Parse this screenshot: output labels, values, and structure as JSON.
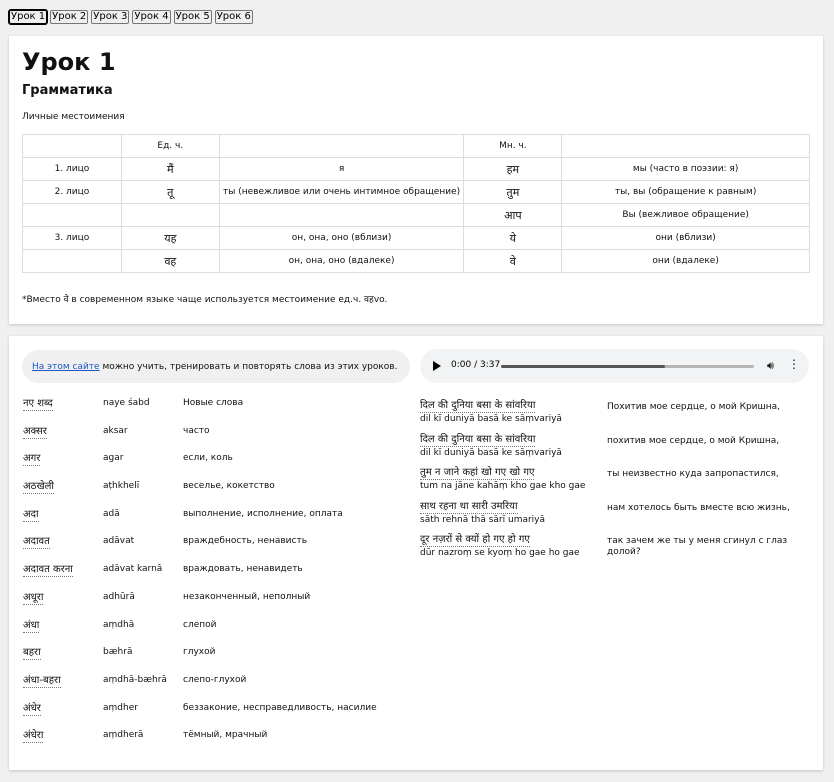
{
  "tabs": [
    "Урок 1",
    "Урок 2",
    "Урок 3",
    "Урок 4",
    "Урок 5",
    "Урок 6"
  ],
  "active_tab": 0,
  "lesson": {
    "title": "Урок 1",
    "section": "Грамматика",
    "subsection": "Личные местоимения",
    "table": {
      "head": [
        "",
        "Ед. ч.",
        "",
        "Мн. ч.",
        ""
      ],
      "rows": [
        [
          "1. лицо",
          "मैं",
          "я",
          "हम",
          "мы (часто в поэзии: я)"
        ],
        [
          "2. лицо",
          "तू",
          "ты (невежливое или очень интимное обращение)",
          "तुम",
          "ты, вы (обращение к равным)"
        ],
        [
          "",
          "",
          "",
          "आप",
          "Вы (вежливое обращение)"
        ],
        [
          "3. лицо",
          "यह",
          "он, она, оно (вблизи)",
          "ये",
          "они (вблизи)"
        ],
        [
          "",
          "वह",
          "он, она, оно (вдалеке)",
          "वे",
          "они (вдалеке)"
        ]
      ]
    },
    "footnote": "*Вместо वे в современном языке чаще используется местоимение ед.ч. वहvo."
  },
  "promo": {
    "link_text": "На этом сайте",
    "rest": " можно учить, тренировать и повторять слова из этих уроков."
  },
  "audio": {
    "time": "0:00 / 3:37",
    "buffered_fraction": 0.65
  },
  "vocab": [
    {
      "word": "नए शब्द",
      "translit": "naye śabd",
      "ru": "Новые слова"
    },
    {
      "word": "अक्सर",
      "translit": "aksar",
      "ru": "часто"
    },
    {
      "word": "अगर",
      "translit": "agar",
      "ru": "если, коль"
    },
    {
      "word": "अठखेली",
      "translit": "aṭhkhelī",
      "ru": "веселье, кокетство"
    },
    {
      "word": "अदा",
      "translit": "adā",
      "ru": "выполнение, исполнение, оплата"
    },
    {
      "word": "अदावत",
      "translit": "adāvat",
      "ru": "враждебность, ненависть"
    },
    {
      "word": "अदावत करना",
      "translit": "adāvat karnā",
      "ru": "враждовать, ненавидеть"
    },
    {
      "word": "अधूरा",
      "translit": "adhūrā",
      "ru": "незаконченный, неполный"
    },
    {
      "word": "अंधा",
      "translit": "aṃdhā",
      "ru": "слепой"
    },
    {
      "word": "बहरा",
      "translit": "bæhrā",
      "ru": "глухой"
    },
    {
      "word": "अंधा-बहरा",
      "translit": "aṃdhā-bæhrā",
      "ru": "слепо-глухой"
    },
    {
      "word": "अंधेर",
      "translit": "aṃdher",
      "ru": "беззаконие, несправедливость, насилие"
    },
    {
      "word": "अंधेरा",
      "translit": "aṃdherā",
      "ru": "тёмный, мрачный"
    }
  ],
  "lyrics": [
    {
      "hindi": "दिल की दुनिया बसा के सांवरिया",
      "translit": "dil kī duniyā basā ke sāṃvariyā",
      "ru": "Похитив мое сердце, о мой Кришна,"
    },
    {
      "hindi": "दिल की दुनिया बसा के सांवरिया",
      "translit": "dil kī duniyā basā ke sāṃvariyā",
      "ru": "похитив мое сердце, о мой Кришна,"
    },
    {
      "hindi": "तुम न जाने कहां खो गए खो गए",
      "translit": "tum na jāne kahāṃ kho gae kho gae",
      "ru": "ты неизвестно куда запропастился,"
    },
    {
      "hindi": "साथ रहना था सारी उमरिया",
      "translit": "sāth rehnā thā sārī umariyā",
      "ru": "нам хотелось быть вместе всю жизнь,"
    },
    {
      "hindi": "दूर नज़रों से क्यों हो गए हो गए",
      "translit": "dūr nazroṃ se kyoṃ ho gae ho gae",
      "ru": "так зачем же ты у меня сгинул с глаз долой?"
    }
  ]
}
